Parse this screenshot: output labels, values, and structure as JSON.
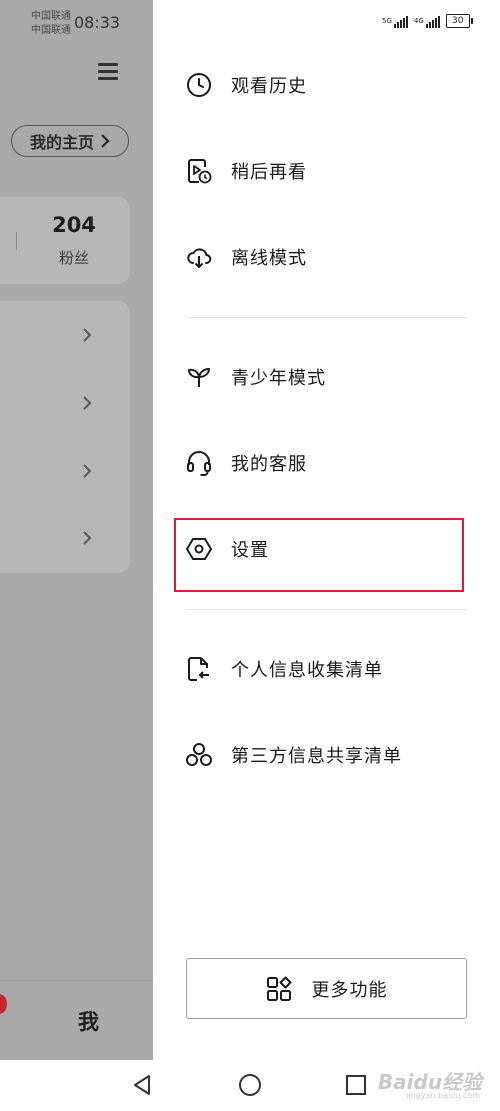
{
  "status_bar": {
    "carrier_1": "中国联通",
    "carrier_2": "中国联通",
    "time": "08:33",
    "signal_1": "5G",
    "signal_2": "4G",
    "battery": "30"
  },
  "background_page": {
    "homepage_button": "我的主页",
    "fans_count": "204",
    "fans_label": "粉丝",
    "bottom_tab_me": "我"
  },
  "drawer": {
    "menu_group_1": [
      {
        "label": "观看历史",
        "icon": "clock-icon"
      },
      {
        "label": "稍后再看",
        "icon": "watch-later-icon"
      },
      {
        "label": "离线模式",
        "icon": "cloud-download-icon"
      }
    ],
    "menu_group_2": [
      {
        "label": "青少年模式",
        "icon": "sprout-icon"
      },
      {
        "label": "我的客服",
        "icon": "headset-icon"
      },
      {
        "label": "设置",
        "icon": "settings-hexagon-icon",
        "highlighted": true
      }
    ],
    "menu_group_3": [
      {
        "label": "个人信息收集清单",
        "icon": "document-arrow-icon"
      },
      {
        "label": "第三方信息共享清单",
        "icon": "share-circles-icon"
      }
    ],
    "more_button": {
      "label": "更多功能",
      "icon": "grid-apps-icon"
    }
  },
  "system_nav": {
    "buttons": [
      "back-icon",
      "home-icon",
      "recents-icon"
    ]
  },
  "watermark": {
    "text": "Baidu经验",
    "sub": "jingyan.baidu.com"
  },
  "colors": {
    "highlight": "#d61f36",
    "dim_overlay": "#a9a9a9"
  }
}
